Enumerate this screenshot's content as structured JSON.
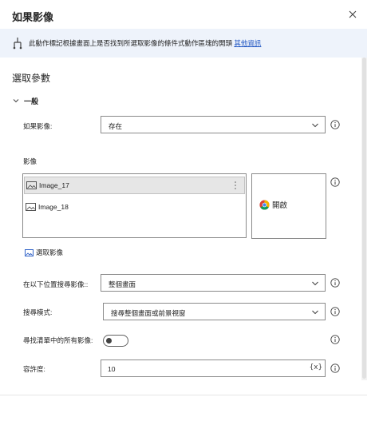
{
  "dialog": {
    "title": "如果影像",
    "close_label": "×"
  },
  "banner": {
    "text": "此動作標記根據畫面上是否找到所選取影像的條件式動作區塊的開頭",
    "link": "其他資訊"
  },
  "section_title": "選取參數",
  "group": {
    "label": "一般"
  },
  "fields": {
    "if_image": {
      "label": "如果影像:",
      "value": "存在"
    },
    "images": {
      "label": "影像",
      "items": [
        {
          "name": "Image_17",
          "selected": true
        },
        {
          "name": "Image_18",
          "selected": false
        }
      ],
      "preview_text": "開啟",
      "select_link": "選取影像"
    },
    "search_in": {
      "label": "在以下位置搜尋影像::",
      "value": "整個畫面"
    },
    "search_mode": {
      "label": "搜尋模式:",
      "value": "搜尋整個畫面或前景視窗"
    },
    "find_all": {
      "label": "尋找清單中的所有影像:",
      "on": false
    },
    "tolerance": {
      "label": "容許度:",
      "value": "10",
      "var_button": "{x}"
    }
  },
  "colors": {
    "banner_bg": "#eef3fb",
    "link": "#1f55c2",
    "border": "#8a8a8a"
  },
  "icons": [
    "flowchart-branch-icon",
    "close-icon",
    "chevron-down-icon",
    "info-icon",
    "image-icon",
    "more-vertical-icon",
    "chrome-icon"
  ]
}
